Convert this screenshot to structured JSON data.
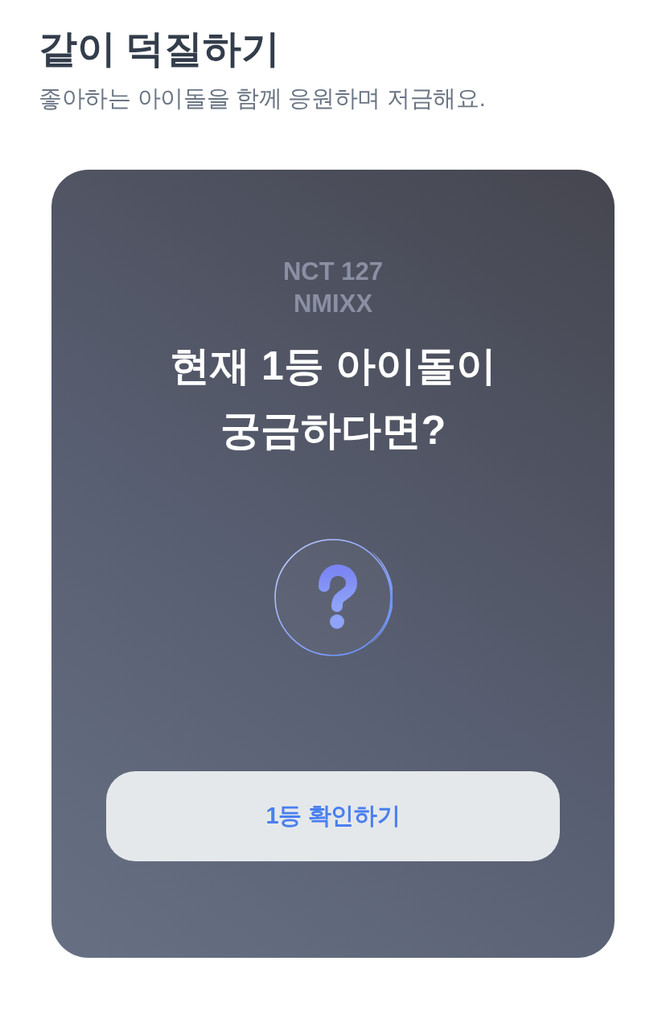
{
  "header": {
    "title": "같이 덕질하기",
    "subtitle": "좋아하는 아이돌을 함께 응원하며 저금해요."
  },
  "card": {
    "background_names": [
      "NCT 127",
      "NMIXX"
    ],
    "headline_lines": [
      "현재 1등 아이돌이",
      "궁금하다면?"
    ],
    "button": "1등 확인하기"
  }
}
